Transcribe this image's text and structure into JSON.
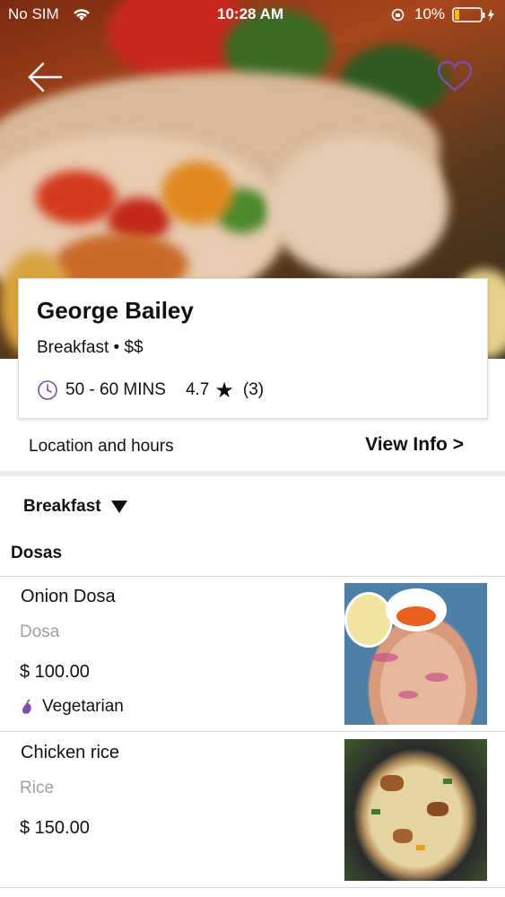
{
  "status_bar": {
    "carrier": "No SIM",
    "time": "10:28 AM",
    "battery": "10%"
  },
  "hero": {
    "back_icon": "back-arrow-icon",
    "favorite_icon": "heart-outline-icon"
  },
  "restaurant": {
    "name": "George Bailey",
    "subtitle": "Breakfast • $$",
    "delivery_time": "50 - 60 MINS",
    "rating": "4.7",
    "reviews": "(3)"
  },
  "location": {
    "label": "Location and hours",
    "link": "View Info >"
  },
  "menu_selector": {
    "label": "Breakfast"
  },
  "section": {
    "title": "Dosas"
  },
  "items": [
    {
      "name": "Onion Dosa",
      "category": "Dosa",
      "price": "$ 100.00",
      "tag": "Vegetarian"
    },
    {
      "name": "Chicken rice",
      "category": "Rice",
      "price": "$ 150.00"
    }
  ],
  "colors": {
    "accent": "#7b4fa8",
    "text": "#111111",
    "muted": "#a0a0a0"
  }
}
